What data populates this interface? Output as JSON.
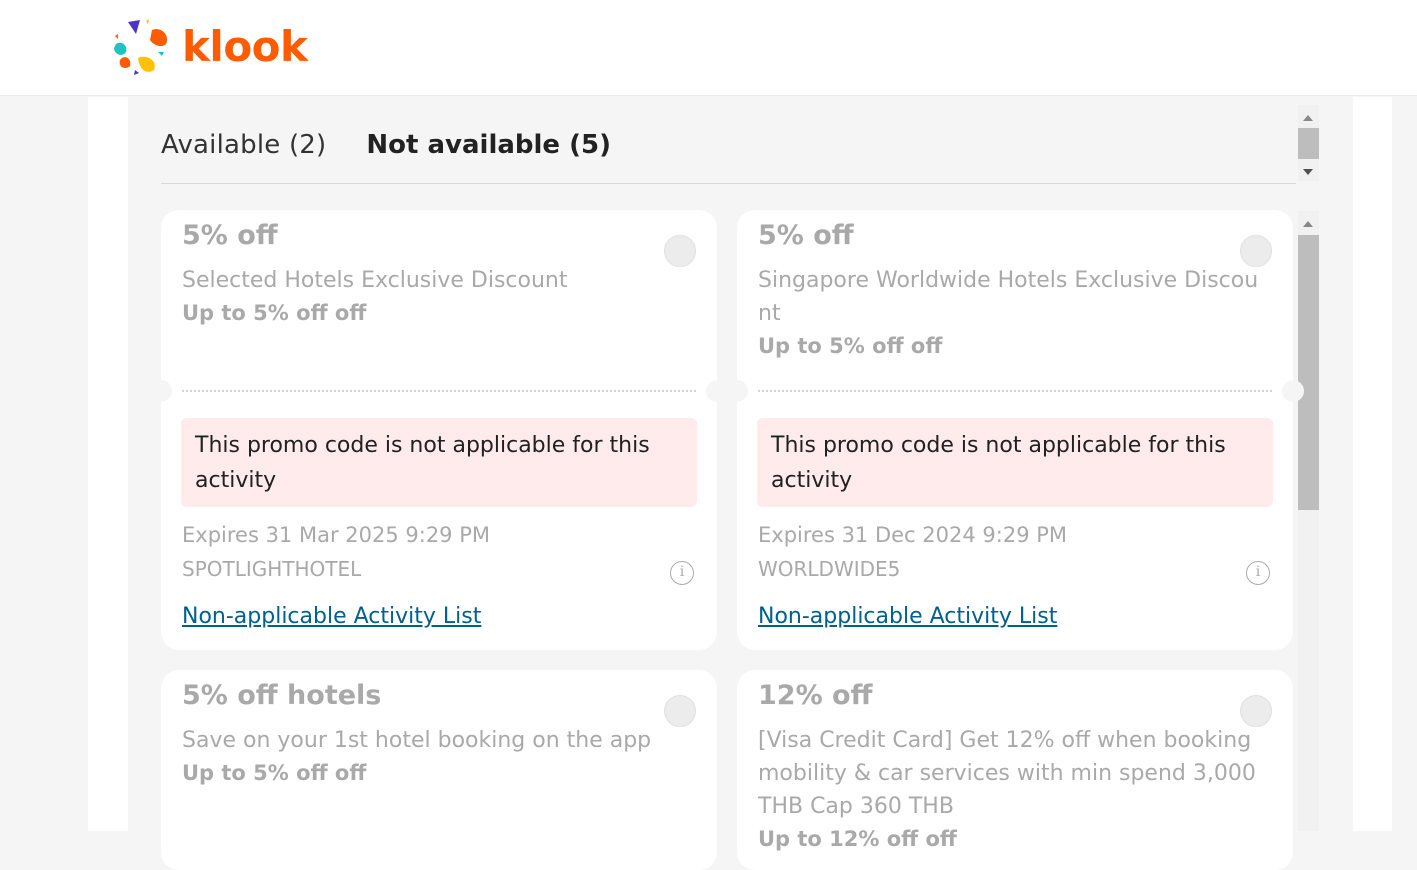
{
  "header": {
    "brand": "klook",
    "brand_color": "#ff5b00"
  },
  "tabs": [
    {
      "label": "Available (2)",
      "active": false
    },
    {
      "label": "Not available (5)",
      "active": true
    }
  ],
  "promos": [
    {
      "title": "5% off",
      "description": "Selected Hotels Exclusive Discount",
      "subtitle": "Up to 5% off off",
      "warning": "This promo code is not applicable for this activity",
      "expires": "Expires 31 Mar 2025 9:29 PM",
      "code": "SPOTLIGHTHOTEL",
      "link": "Non-applicable Activity List"
    },
    {
      "title": "5% off",
      "description": "Singapore Worldwide Hotels Exclusive Discount",
      "subtitle": "Up to 5% off off",
      "warning": "This promo code is not applicable for this activity",
      "expires": "Expires 31 Dec 2024 9:29 PM",
      "code": "WORLDWIDE5",
      "link": "Non-applicable Activity List"
    },
    {
      "title": "5% off hotels",
      "description": "Save on your 1st hotel booking on the app",
      "subtitle": "Up to 5% off off"
    },
    {
      "title": "12% off",
      "description": "[Visa Credit Card] Get 12% off when booking mobility & car services with min spend 3,000 THB Cap 360 THB",
      "subtitle": "Up to 12% off off"
    }
  ],
  "icons": {
    "info": "i"
  }
}
